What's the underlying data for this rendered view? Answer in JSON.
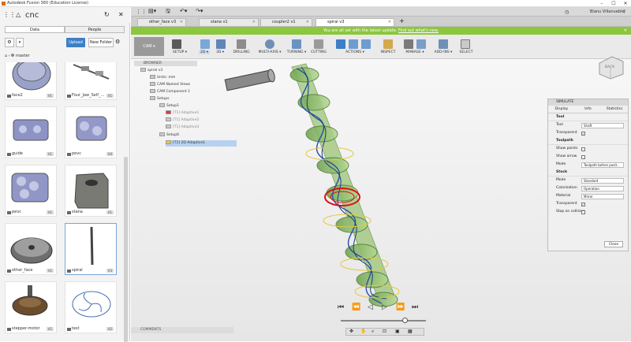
{
  "window": {
    "title": "Autodesk Fusion 360 (Education License)",
    "user": "Blanu Villanueble"
  },
  "data_panel": {
    "project": "cnc",
    "tabs": [
      {
        "label": "Data",
        "active": true
      },
      {
        "label": "People",
        "active": false
      }
    ],
    "upload_label": "Upload",
    "new_folder_label": "New Folder",
    "breadcrumb": "master",
    "items": [
      {
        "name": "face2",
        "version": "V1"
      },
      {
        "name": "Four_Jaw_Self_...",
        "version": "V1"
      },
      {
        "name": "guide",
        "version": "V1"
      },
      {
        "name": "pevc",
        "version": "V4"
      },
      {
        "name": "pevc",
        "version": "V1"
      },
      {
        "name": "stana",
        "version": "V1"
      },
      {
        "name": "other_face",
        "version": "V1"
      },
      {
        "name": "spiral",
        "version": "V3"
      },
      {
        "name": "stepper-motor",
        "version": "V1"
      },
      {
        "name": "test",
        "version": "V2"
      }
    ]
  },
  "doc_tabs": [
    {
      "label": "other_face v3",
      "active": false
    },
    {
      "label": "stana v1",
      "active": false
    },
    {
      "label": "coupler2 v1",
      "active": false
    },
    {
      "label": "spiral v3",
      "active": true
    }
  ],
  "banner": {
    "text": "You are all set with the latest update.",
    "link": "Find out what's new."
  },
  "ribbon": {
    "workspace": "CAM ▾",
    "groups": [
      "SETUP ▾",
      "2D ▾",
      "3D ▾",
      "DRILLING",
      "MULTI-AXIS ▾",
      "TURNING ▾",
      "CUTTING",
      "ACTIONS ▾",
      "INSPECT",
      "MANAGE ▾",
      "ADD-INS ▾",
      "SELECT"
    ],
    "accent": "#3c7fc6"
  },
  "browser": {
    "header": "BROWSER",
    "rows": [
      {
        "label": "spiral v3",
        "indent": 0
      },
      {
        "label": "Units: mm",
        "indent": 1
      },
      {
        "label": "CAM Named Views",
        "indent": 1
      },
      {
        "label": "CAM Component 1",
        "indent": 1
      },
      {
        "label": "Setups",
        "indent": 1
      },
      {
        "label": "Setup1",
        "indent": 2
      },
      {
        "label": "[T1] Adaptive1",
        "indent": 3
      },
      {
        "label": "[T1] Adaptive2",
        "indent": 3
      },
      {
        "label": "[T1] Adaptive3",
        "indent": 3
      },
      {
        "label": "Setup6",
        "indent": 2
      },
      {
        "label": "[T1] 2D Adaptive1",
        "indent": 3
      }
    ]
  },
  "simulate": {
    "title": "SIMULATE",
    "tabs": [
      "Display",
      "Info",
      "Statistics"
    ],
    "tool": {
      "section": "Tool",
      "tool_label": "Tool",
      "tool_value": "Shaft",
      "transparent_label": "Transparent",
      "transparent": true
    },
    "toolpath": {
      "section": "Toolpath",
      "show_points": "Show points",
      "show_points_checked": false,
      "show_arrow": "Show arrow",
      "show_arrow_checked": false,
      "mode_label": "Mode",
      "mode_value": "Toolpath before posit..."
    },
    "stock": {
      "section": "Stock",
      "mode_label": "Mode",
      "mode_value": "Standard",
      "color_label": "Colorization",
      "color_value": "Operation",
      "material_label": "Material",
      "material_value": "Mirror",
      "transparent_label": "Transparent",
      "transparent": true,
      "stop_label": "Stop on collision",
      "stop": false
    },
    "close_label": "Close"
  },
  "comments": "COMMENTS",
  "viewcube": "BACK",
  "player": [
    "⏮",
    "⏪",
    "◁",
    "▷",
    "⏩",
    "⏭"
  ]
}
